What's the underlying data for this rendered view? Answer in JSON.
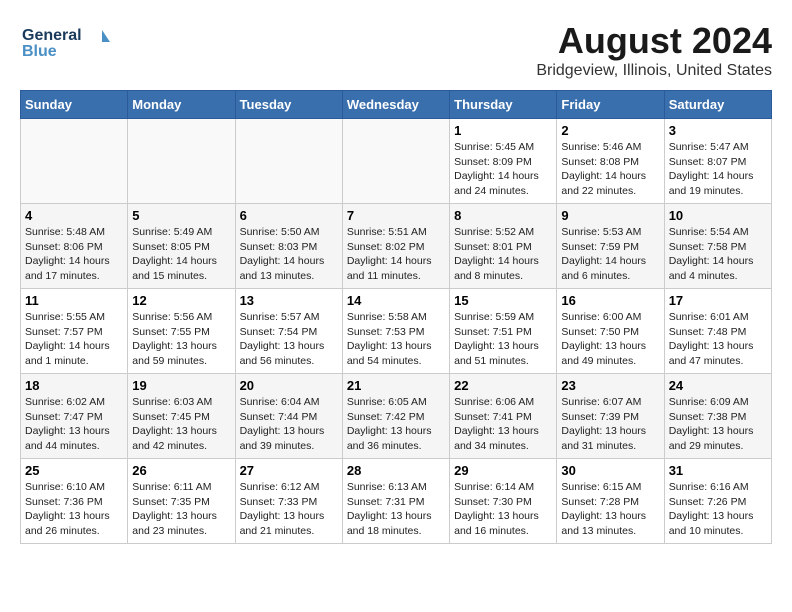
{
  "logo": {
    "line1": "General",
    "line2": "Blue"
  },
  "title": "August 2024",
  "subtitle": "Bridgeview, Illinois, United States",
  "days_of_week": [
    "Sunday",
    "Monday",
    "Tuesday",
    "Wednesday",
    "Thursday",
    "Friday",
    "Saturday"
  ],
  "weeks": [
    {
      "cells": [
        {
          "day": "",
          "info": ""
        },
        {
          "day": "",
          "info": ""
        },
        {
          "day": "",
          "info": ""
        },
        {
          "day": "",
          "info": ""
        },
        {
          "day": "1",
          "info": "Sunrise: 5:45 AM\nSunset: 8:09 PM\nDaylight: 14 hours\nand 24 minutes."
        },
        {
          "day": "2",
          "info": "Sunrise: 5:46 AM\nSunset: 8:08 PM\nDaylight: 14 hours\nand 22 minutes."
        },
        {
          "day": "3",
          "info": "Sunrise: 5:47 AM\nSunset: 8:07 PM\nDaylight: 14 hours\nand 19 minutes."
        }
      ]
    },
    {
      "cells": [
        {
          "day": "4",
          "info": "Sunrise: 5:48 AM\nSunset: 8:06 PM\nDaylight: 14 hours\nand 17 minutes."
        },
        {
          "day": "5",
          "info": "Sunrise: 5:49 AM\nSunset: 8:05 PM\nDaylight: 14 hours\nand 15 minutes."
        },
        {
          "day": "6",
          "info": "Sunrise: 5:50 AM\nSunset: 8:03 PM\nDaylight: 14 hours\nand 13 minutes."
        },
        {
          "day": "7",
          "info": "Sunrise: 5:51 AM\nSunset: 8:02 PM\nDaylight: 14 hours\nand 11 minutes."
        },
        {
          "day": "8",
          "info": "Sunrise: 5:52 AM\nSunset: 8:01 PM\nDaylight: 14 hours\nand 8 minutes."
        },
        {
          "day": "9",
          "info": "Sunrise: 5:53 AM\nSunset: 7:59 PM\nDaylight: 14 hours\nand 6 minutes."
        },
        {
          "day": "10",
          "info": "Sunrise: 5:54 AM\nSunset: 7:58 PM\nDaylight: 14 hours\nand 4 minutes."
        }
      ]
    },
    {
      "cells": [
        {
          "day": "11",
          "info": "Sunrise: 5:55 AM\nSunset: 7:57 PM\nDaylight: 14 hours\nand 1 minute."
        },
        {
          "day": "12",
          "info": "Sunrise: 5:56 AM\nSunset: 7:55 PM\nDaylight: 13 hours\nand 59 minutes."
        },
        {
          "day": "13",
          "info": "Sunrise: 5:57 AM\nSunset: 7:54 PM\nDaylight: 13 hours\nand 56 minutes."
        },
        {
          "day": "14",
          "info": "Sunrise: 5:58 AM\nSunset: 7:53 PM\nDaylight: 13 hours\nand 54 minutes."
        },
        {
          "day": "15",
          "info": "Sunrise: 5:59 AM\nSunset: 7:51 PM\nDaylight: 13 hours\nand 51 minutes."
        },
        {
          "day": "16",
          "info": "Sunrise: 6:00 AM\nSunset: 7:50 PM\nDaylight: 13 hours\nand 49 minutes."
        },
        {
          "day": "17",
          "info": "Sunrise: 6:01 AM\nSunset: 7:48 PM\nDaylight: 13 hours\nand 47 minutes."
        }
      ]
    },
    {
      "cells": [
        {
          "day": "18",
          "info": "Sunrise: 6:02 AM\nSunset: 7:47 PM\nDaylight: 13 hours\nand 44 minutes."
        },
        {
          "day": "19",
          "info": "Sunrise: 6:03 AM\nSunset: 7:45 PM\nDaylight: 13 hours\nand 42 minutes."
        },
        {
          "day": "20",
          "info": "Sunrise: 6:04 AM\nSunset: 7:44 PM\nDaylight: 13 hours\nand 39 minutes."
        },
        {
          "day": "21",
          "info": "Sunrise: 6:05 AM\nSunset: 7:42 PM\nDaylight: 13 hours\nand 36 minutes."
        },
        {
          "day": "22",
          "info": "Sunrise: 6:06 AM\nSunset: 7:41 PM\nDaylight: 13 hours\nand 34 minutes."
        },
        {
          "day": "23",
          "info": "Sunrise: 6:07 AM\nSunset: 7:39 PM\nDaylight: 13 hours\nand 31 minutes."
        },
        {
          "day": "24",
          "info": "Sunrise: 6:09 AM\nSunset: 7:38 PM\nDaylight: 13 hours\nand 29 minutes."
        }
      ]
    },
    {
      "cells": [
        {
          "day": "25",
          "info": "Sunrise: 6:10 AM\nSunset: 7:36 PM\nDaylight: 13 hours\nand 26 minutes."
        },
        {
          "day": "26",
          "info": "Sunrise: 6:11 AM\nSunset: 7:35 PM\nDaylight: 13 hours\nand 23 minutes."
        },
        {
          "day": "27",
          "info": "Sunrise: 6:12 AM\nSunset: 7:33 PM\nDaylight: 13 hours\nand 21 minutes."
        },
        {
          "day": "28",
          "info": "Sunrise: 6:13 AM\nSunset: 7:31 PM\nDaylight: 13 hours\nand 18 minutes."
        },
        {
          "day": "29",
          "info": "Sunrise: 6:14 AM\nSunset: 7:30 PM\nDaylight: 13 hours\nand 16 minutes."
        },
        {
          "day": "30",
          "info": "Sunrise: 6:15 AM\nSunset: 7:28 PM\nDaylight: 13 hours\nand 13 minutes."
        },
        {
          "day": "31",
          "info": "Sunrise: 6:16 AM\nSunset: 7:26 PM\nDaylight: 13 hours\nand 10 minutes."
        }
      ]
    }
  ],
  "colors": {
    "header_bg": "#3a6fad",
    "header_text": "#ffffff",
    "title_color": "#1a1a1a",
    "logo_color": "#1a3a5c",
    "logo_accent": "#4a90c4"
  }
}
